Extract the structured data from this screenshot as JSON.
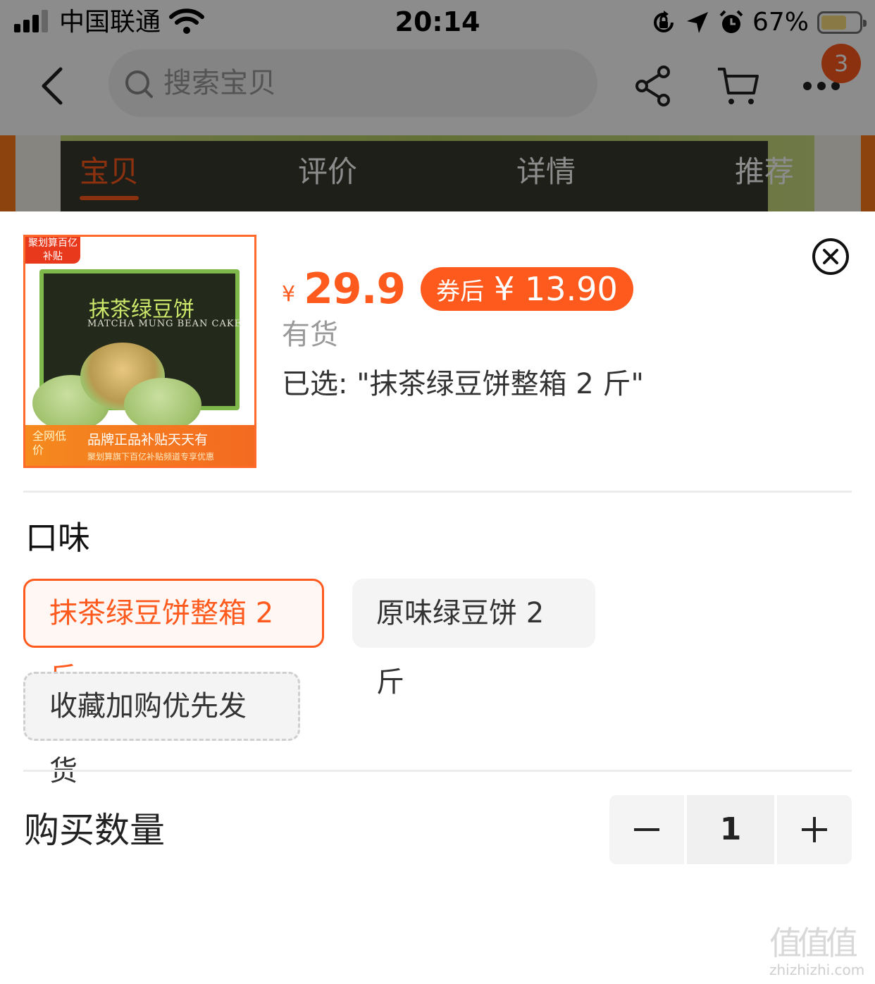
{
  "status_bar": {
    "carrier": "中国联通",
    "time": "20:14",
    "battery": "67%",
    "battery_level": 0.67
  },
  "nav": {
    "search_placeholder": "搜索宝贝",
    "cart_badge": "3"
  },
  "tabs": [
    "宝贝",
    "评价",
    "详情",
    "推荐"
  ],
  "thumbnail": {
    "corner_label": "聚划算百亿补贴",
    "product_title": "抹茶绿豆饼",
    "product_subtitle": "MATCHA MUNG BEAN CAKE",
    "footer_left": "全网低价",
    "footer_title": "品牌正品补贴天天有",
    "footer_sub": "聚划算旗下百亿补贴频道专享优惠"
  },
  "product": {
    "currency": "¥",
    "price": "29.9",
    "coupon_label": "券后",
    "coupon_price": "¥ 13.90",
    "stock": "有货",
    "selected": "已选: \"抹茶绿豆饼整箱 2 斤\""
  },
  "flavor": {
    "title": "口味",
    "options": [
      "抹茶绿豆饼整箱 2 斤",
      "原味绿豆饼 2 斤",
      "收藏加购优先发货"
    ]
  },
  "quantity": {
    "label": "购买数量",
    "value": "1"
  },
  "watermark": {
    "logo": "值值值",
    "url": "zhizhizhi.com"
  },
  "colors": {
    "accent": "#ff5a1e",
    "muted_text": "#999999",
    "chip_bg": "#f4f4f4"
  }
}
